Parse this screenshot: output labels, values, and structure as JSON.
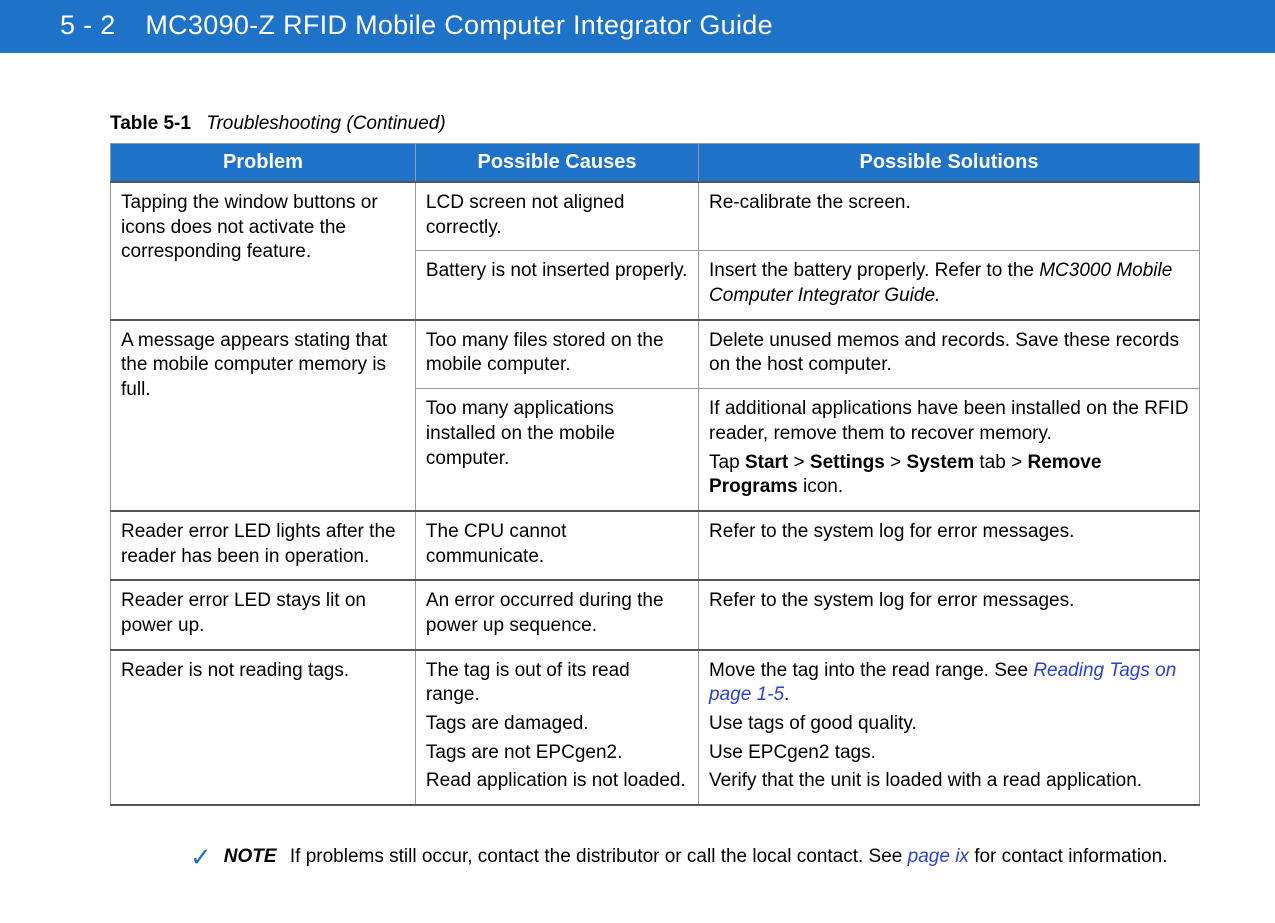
{
  "header": {
    "page_number": "5 - 2",
    "title": "MC3090-Z RFID Mobile Computer Integrator Guide"
  },
  "table_caption": {
    "label": "Table 5-1",
    "title": "Troubleshooting (Continued)"
  },
  "columns": {
    "problem": "Problem",
    "causes": "Possible Causes",
    "solutions": "Possible Solutions"
  },
  "rows": {
    "r1": {
      "problem": "Tapping the window buttons or icons does not activate the corresponding feature.",
      "cause": "LCD screen not aligned correctly.",
      "solution": "Re-calibrate the screen."
    },
    "r2": {
      "cause": "Battery is not inserted properly.",
      "solution_pre": "Insert the battery properly. Refer to the ",
      "solution_ref": "MC3000 Mobile Computer Integrator Guide.",
      "solution_post": ""
    },
    "r3": {
      "problem": "A message appears stating that the mobile computer memory is full.",
      "cause": "Too many files stored on the mobile computer.",
      "solution": "Delete unused memos and records. Save these records on the host computer."
    },
    "r4": {
      "cause": "Too many applications installed on the mobile computer.",
      "solution_line1": "If additional applications have been installed on the RFID reader, remove them to recover memory.",
      "tap": "Tap ",
      "start": "Start",
      "gt1": " > ",
      "settings": "Settings",
      "gt2": " > ",
      "system": "System",
      "tab": " tab > ",
      "remove": "Remove Programs",
      "icon": " icon."
    },
    "r5": {
      "problem": "Reader error LED lights after the reader has been in operation.",
      "cause": "The CPU cannot communicate.",
      "solution": "Refer to the system log for error messages."
    },
    "r6": {
      "problem": "Reader error LED stays lit on power up.",
      "cause": "An error occurred during the power up sequence.",
      "solution": "Refer to the system log for error messages."
    },
    "r7": {
      "problem": "Reader is not reading tags.",
      "cause1": "The tag is out of its read range.",
      "cause2": "Tags are damaged.",
      "cause3": "Tags are not EPCgen2.",
      "cause4": "Read application is not loaded.",
      "sol1_pre": "Move the tag into the read range. See ",
      "sol1_link": "Reading Tags on page 1-5",
      "sol1_post": ".",
      "sol2": "Use tags of good quality.",
      "sol3": "Use EPCgen2 tags.",
      "sol4": "Verify that the unit is loaded with a read application."
    }
  },
  "note": {
    "label": "NOTE",
    "text_pre": "If problems still occur, contact the distributor or call the local contact. See  ",
    "link": "page ix",
    "text_post": " for contact information."
  }
}
